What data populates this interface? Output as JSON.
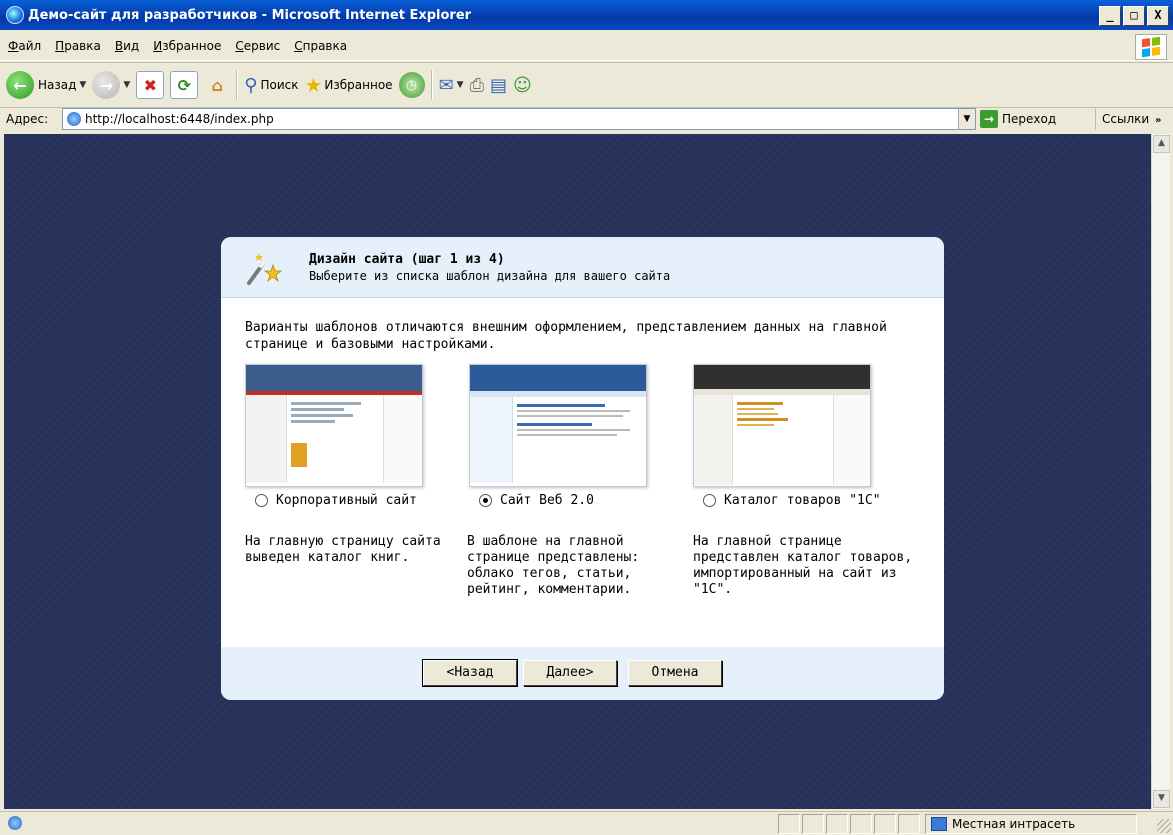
{
  "window": {
    "title": "Демо-сайт для разработчиков - Microsoft Internet Explorer",
    "minimize": "_",
    "maximize": "□",
    "close": "X"
  },
  "menu": [
    "Файл",
    "Правка",
    "Вид",
    "Избранное",
    "Сервис",
    "Справка"
  ],
  "toolbar": {
    "back": "Назад",
    "search": "Поиск",
    "favorites": "Избранное"
  },
  "address": {
    "label": "Адрес:",
    "url": "http://localhost:6448/index.php",
    "go": "Переход",
    "links": "Ссылки"
  },
  "dialog": {
    "title": "Дизайн сайта (шаг 1 из 4)",
    "subtitle": "Выберите из списка шаблон дизайна для вашего сайта",
    "intro": "Варианты шаблонов отличаются внешним оформлением, представлением данных на главной странице и базовыми настройками.",
    "options": [
      {
        "label": "Корпоративный сайт",
        "selected": false,
        "desc": "На главную страницу сайта выведен каталог книг."
      },
      {
        "label": "Сайт Веб 2.0",
        "selected": true,
        "desc": "В шаблоне на главной странице представлены: облако тегов, статьи, рейтинг, комментарии."
      },
      {
        "label": "Каталог товаров \"1С\"",
        "selected": false,
        "desc": "На главной странице представлен каталог товаров, импортированный на сайт из \"1С\"."
      }
    ],
    "buttons": {
      "back": "<Назад",
      "next": "Далее>",
      "cancel": "Отмена"
    }
  },
  "status": {
    "zone": "Местная интрасеть"
  },
  "colors": {
    "page_bg": "#27325a",
    "dialog_header": "#e6f0fb",
    "titlebar": "#0339a6"
  }
}
